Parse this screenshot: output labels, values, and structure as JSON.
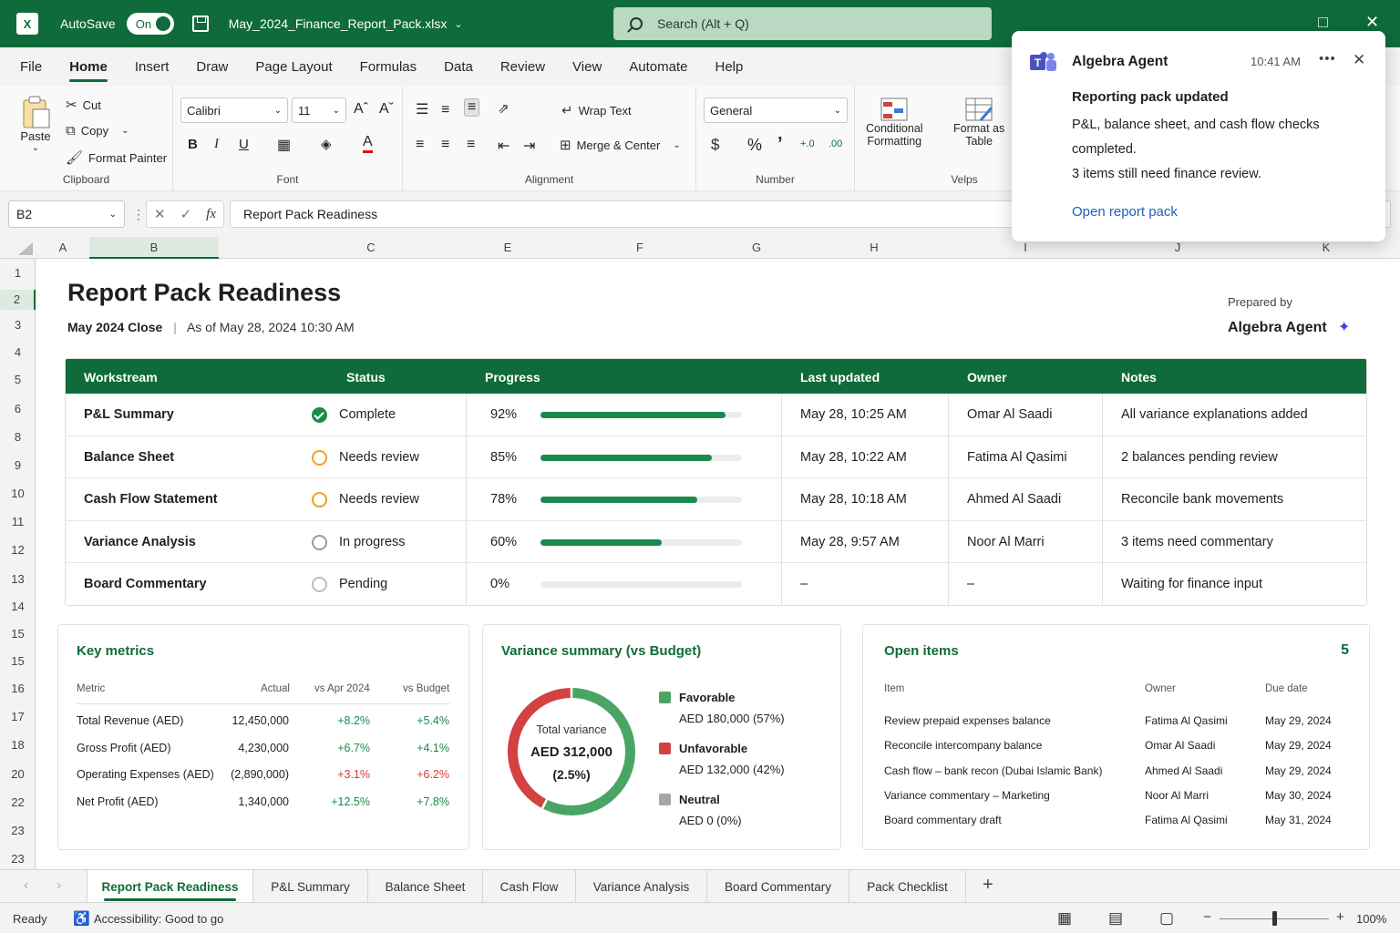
{
  "titlebar": {
    "autosave_label": "AutoSave",
    "autosave_state": "On",
    "filename": "May_2024_Finance_Report_Pack.xlsx",
    "search_placeholder": "Search (Alt + Q)"
  },
  "menu": [
    "File",
    "Home",
    "Insert",
    "Draw",
    "Page Layout",
    "Formulas",
    "Data",
    "Review",
    "View",
    "Automate",
    "Help"
  ],
  "ribbon": {
    "paste": "Paste",
    "cut": "Cut",
    "copy": "Copy",
    "format_painter": "Format Painter",
    "clipboard": "Clipboard",
    "font_name": "Calibri",
    "font_size": "11",
    "font": "Font",
    "wrap_text": "Wrap Text",
    "merge_center": "Merge & Center",
    "alignment": "Alignment",
    "number_format": "General",
    "number": "Number",
    "conditional_formatting_1": "Conditional",
    "conditional_formatting_2": "Formatting",
    "format_table_1": "Format as",
    "format_table_2": "Table",
    "helps": "Velps"
  },
  "formula_bar": {
    "name_box": "B2",
    "content": "Report Pack Readiness"
  },
  "columns": [
    "A",
    "B",
    "C",
    "E",
    "F",
    "G",
    "H",
    "I",
    "J",
    "K"
  ],
  "rows": [
    "1",
    "2",
    "3",
    "4",
    "5",
    "6",
    "8",
    "9",
    "10",
    "11",
    "12",
    "13",
    "14",
    "15",
    "15",
    "16",
    "17",
    "18",
    "20",
    "22",
    "23",
    "23"
  ],
  "sheet": {
    "title": "Report Pack Readiness",
    "period": "May 2024 Close",
    "as_of": "As of May 28, 2024 10:30 AM",
    "prepared_by_label": "Prepared by",
    "prepared_by": "Algebra Agent"
  },
  "table": {
    "headers": [
      "Workstream",
      "Status",
      "Progress",
      "Last updated",
      "Owner",
      "Notes"
    ],
    "rows": [
      {
        "workstream": "P&L Summary",
        "status": "Complete",
        "status_kind": "complete",
        "progress": "92%",
        "progress_value": 92,
        "updated": "May 28, 10:25 AM",
        "owner": "Omar Al Saadi",
        "notes": "All variance explanations added"
      },
      {
        "workstream": "Balance Sheet",
        "status": "Needs review",
        "status_kind": "review",
        "progress": "85%",
        "progress_value": 85,
        "updated": "May 28, 10:22 AM",
        "owner": "Fatima Al Qasimi",
        "notes": "2 balances pending review"
      },
      {
        "workstream": "Cash Flow Statement",
        "status": "Needs review",
        "status_kind": "review",
        "progress": "78%",
        "progress_value": 78,
        "updated": "May 28, 10:18 AM",
        "owner": "Ahmed Al Saadi",
        "notes": "Reconcile bank movements"
      },
      {
        "workstream": "Variance Analysis",
        "status": "In progress",
        "status_kind": "progress",
        "progress": "60%",
        "progress_value": 60,
        "updated": "May 28, 9:57 AM",
        "owner": "Noor Al Marri",
        "notes": "3 items need commentary"
      },
      {
        "workstream": "Board Commentary",
        "status": "Pending",
        "status_kind": "pending",
        "progress": "0%",
        "progress_value": 0,
        "updated": "–",
        "owner": "–",
        "notes": "Waiting for finance input"
      }
    ]
  },
  "key_metrics": {
    "title": "Key metrics",
    "headers": [
      "Metric",
      "Actual",
      "vs Apr 2024",
      "vs Budget"
    ],
    "rows": [
      {
        "metric": "Total Revenue (AED)",
        "actual": "12,450,000",
        "vs_apr": "+8.2%",
        "vs_apr_color": "green",
        "vs_budget": "+5.4%",
        "vs_budget_color": "green"
      },
      {
        "metric": "Gross Profit (AED)",
        "actual": "4,230,000",
        "vs_apr": "+6.7%",
        "vs_apr_color": "green",
        "vs_budget": "+4.1%",
        "vs_budget_color": "green"
      },
      {
        "metric": "Operating Expenses (AED)",
        "actual": "(2,890,000)",
        "vs_apr": "+3.1%",
        "vs_apr_color": "red",
        "vs_budget": "+6.2%",
        "vs_budget_color": "red"
      },
      {
        "metric": "Net Profit (AED)",
        "actual": "1,340,000",
        "vs_apr": "+12.5%",
        "vs_apr_color": "green",
        "vs_budget": "+7.8%",
        "vs_budget_color": "green"
      }
    ]
  },
  "variance": {
    "title": "Variance summary (vs Budget)",
    "center_label": "Total variance",
    "center_value": "AED 312,000",
    "center_pct": "(2.5%)",
    "segments": [
      {
        "name": "Favorable",
        "value": "AED 180,000  (57%)",
        "share": 57,
        "color": "#4aa564"
      },
      {
        "name": "Unfavorable",
        "value": "AED 132,000  (42%)",
        "share": 42,
        "color": "#d34141"
      },
      {
        "name": "Neutral",
        "value": "AED 0 (0%)",
        "share": 0,
        "color": "#a6a6a6"
      }
    ]
  },
  "open_items": {
    "title": "Open items",
    "count": "5",
    "headers": [
      "Item",
      "Owner",
      "Due date"
    ],
    "rows": [
      {
        "item": "Review prepaid expenses balance",
        "owner": "Fatima Al Qasimi",
        "due": "May 29, 2024"
      },
      {
        "item": "Reconcile intercompany balance",
        "owner": "Omar Al Saadi",
        "due": "May 29, 2024"
      },
      {
        "item": "Cash flow – bank recon (Dubai Islamic Bank)",
        "owner": "Ahmed Al Saadi",
        "due": "May 29, 2024"
      },
      {
        "item": "Variance commentary – Marketing",
        "owner": "Noor Al Marri",
        "due": "May 30, 2024"
      },
      {
        "item": "Board commentary draft",
        "owner": "Fatima Al Qasimi",
        "due": "May 31, 2024"
      }
    ]
  },
  "tabs": [
    "Report Pack Readiness",
    "P&L Summary",
    "Balance Sheet",
    "Cash Flow",
    "Variance Analysis",
    "Board Commentary",
    "Pack Checklist"
  ],
  "status": {
    "ready": "Ready",
    "accessibility": "Accessibility: Good to go",
    "zoom": "100%"
  },
  "notification": {
    "app": "Algebra Agent",
    "time": "10:41 AM",
    "heading": "Reporting pack updated",
    "line1": "P&L, balance sheet, and cash flow checks",
    "line2": "completed.",
    "line3": "3 items still need finance review.",
    "link": "Open report pack"
  },
  "colors": {
    "brand": "#0f6b3a",
    "progress": "#1a8a4c",
    "review": "#f0a21a",
    "link": "#1f5fbf"
  }
}
